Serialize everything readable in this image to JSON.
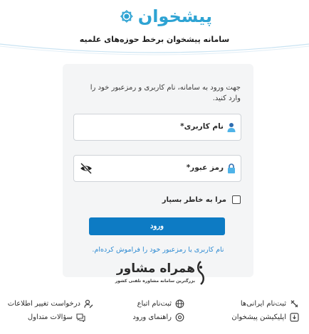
{
  "header": {
    "logo_text": "پیشخوان",
    "system_title": "سامانه پیشخوان برخط حوزه‌های علمیه"
  },
  "login": {
    "intro": "جهت ورود به سامانه، نام کاربری و رمزعبور خود را وارد کنید.",
    "username_label": "نام کاربری*",
    "password_label": "رمز عبور*",
    "remember_label": "مرا به خاطر بسپار",
    "submit_label": "ورود",
    "forgot_link": "نام کاربری یا رمزعبور خود را فراموش کرده‌ام.",
    "remember_checked": false
  },
  "watermark": {
    "title": "همراه مشاور",
    "subtitle": "بزرگترین سامانه مشاوره تلفنی کشور"
  },
  "footer": {
    "links": [
      {
        "label": "ثبت‌نام ایرانی‌ها",
        "icon": "user-register-icon"
      },
      {
        "label": "اپلیکیشن پیشخوان",
        "icon": "download-app-icon"
      },
      {
        "label": "ثبت‌نام اتباع",
        "icon": "globe-icon"
      },
      {
        "label": "راهنمای ورود",
        "icon": "help-icon"
      },
      {
        "label": "درخواست تغییر اطلاعات",
        "icon": "user-edit-icon"
      },
      {
        "label": "سؤالات متداول",
        "icon": "faq-icon"
      }
    ]
  },
  "colors": {
    "brand": "#2ea3d3",
    "button": "#0d7bc4",
    "link": "#2c8ad2",
    "card": "#f4f5f6"
  }
}
